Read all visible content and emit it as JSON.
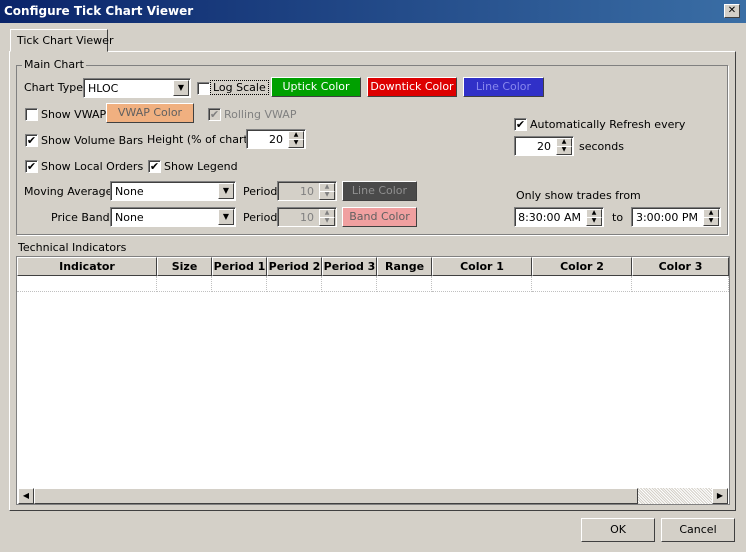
{
  "window": {
    "title": "Configure Tick Chart Viewer",
    "close_glyph": "✕"
  },
  "tabs": [
    {
      "label": "Tick Chart Viewer"
    }
  ],
  "main_chart": {
    "legend": "Main Chart",
    "chart_type": {
      "label": "Chart Type",
      "value": "HLOC"
    },
    "log_scale": {
      "label": "Log Scale",
      "checked": false
    },
    "uptick_color": {
      "label": "Uptick Color",
      "color": "#00a000"
    },
    "downtick_color": {
      "label": "Downtick Color",
      "color": "#dd0000"
    },
    "line_color": {
      "label": "Line Color",
      "color": "#3030c8"
    },
    "show_vwap": {
      "label": "Show VWAP",
      "checked": false
    },
    "vwap_color": {
      "label": "VWAP Color",
      "color": "#f0b080"
    },
    "rolling_vwap": {
      "label": "Rolling VWAP",
      "checked": true,
      "enabled": false
    },
    "show_volume_bars": {
      "label": "Show Volume Bars",
      "checked": true
    },
    "height": {
      "label": "Height (% of chart)",
      "value": "20"
    },
    "show_local_orders": {
      "label": "Show Local Orders",
      "checked": true
    },
    "show_legend": {
      "label": "Show Legend",
      "checked": true
    },
    "moving_average": {
      "label": "Moving Average",
      "value": "None",
      "period_label": "Period",
      "period_value": "10",
      "color_label": "Line Color",
      "color": "#4a4a4a"
    },
    "price_band": {
      "label": "Price Band",
      "value": "None",
      "period_label": "Period",
      "period_value": "10",
      "color_label": "Band Color",
      "color": "#f0a0a0"
    },
    "auto_refresh": {
      "label": "Automatically Refresh every",
      "checked": true,
      "value": "20",
      "unit": "seconds"
    },
    "trade_window": {
      "label": "Only show trades from",
      "from": "8:30:00 AM",
      "to_label": "to",
      "to": "3:00:00 PM"
    }
  },
  "technical_indicators": {
    "label": "Technical Indicators",
    "columns": [
      "Indicator",
      "Size",
      "Period 1",
      "Period 2",
      "Period 3",
      "Range",
      "Color 1",
      "Color 2",
      "Color 3"
    ]
  },
  "buttons": {
    "ok": "OK",
    "cancel": "Cancel"
  },
  "icons": {
    "checkmark": "✔",
    "arrow_down": "▼",
    "arrow_up": "▲",
    "arrow_left": "◀",
    "arrow_right": "▶"
  }
}
